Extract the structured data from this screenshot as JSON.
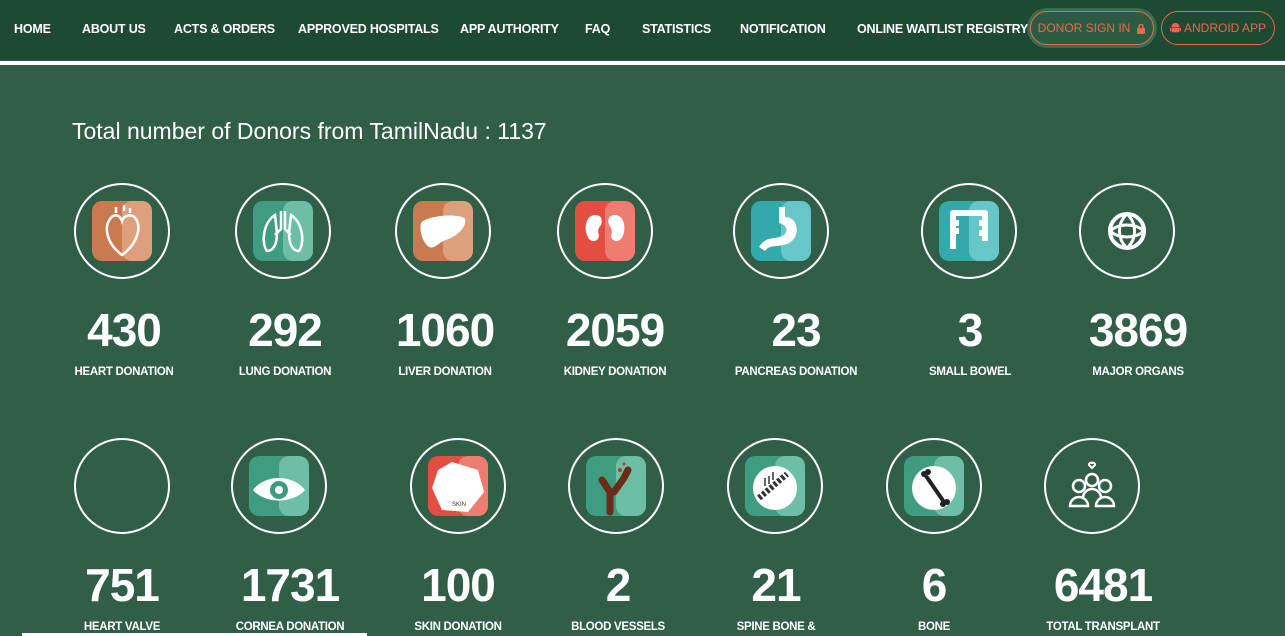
{
  "nav": {
    "items": [
      "HOME",
      "ABOUT US",
      "ACTS & ORDERS",
      "APPROVED HOSPITALS",
      "APP AUTHORITY",
      "FAQ",
      "STATISTICS",
      "NOTIFICATION",
      "ONLINE WAITLIST REGISTRY"
    ],
    "donor_signin": "DONOR SIGN IN",
    "android_app": "ANDROID APP"
  },
  "total_donors": "Total number of Donors from TamilNadu : 1137",
  "row1": [
    {
      "value": "430",
      "label": "HEART DONATION",
      "icon": "heart-icon"
    },
    {
      "value": "292",
      "label": "LUNG DONATION",
      "icon": "lungs-icon"
    },
    {
      "value": "1060",
      "label": "LIVER DONATION",
      "icon": "liver-icon"
    },
    {
      "value": "2059",
      "label": "KIDNEY DONATION",
      "icon": "kidney-icon"
    },
    {
      "value": "23",
      "label": "PANCREAS DONATION",
      "icon": "stomach-icon"
    },
    {
      "value": "3",
      "label": "SMALL BOWEL",
      "icon": "bowel-icon"
    },
    {
      "value": "3869",
      "label": "MAJOR ORGANS",
      "icon": "organs-globe-icon"
    }
  ],
  "row2": [
    {
      "value": "751",
      "label": "HEART VALVE",
      "icon": "heart-valve-icon"
    },
    {
      "value": "1731",
      "label": "CORNEA DONATION",
      "icon": "eye-icon"
    },
    {
      "value": "100",
      "label": "SKIN DONATION",
      "icon": "skin-icon",
      "icon_text": "SKIN"
    },
    {
      "value": "2",
      "label": "BLOOD VESSELS",
      "icon": "blood-vessel-icon"
    },
    {
      "value": "21",
      "label": "SPINE BONE &",
      "icon": "spine-icon"
    },
    {
      "value": "6",
      "label": "BONE",
      "icon": "bone-icon"
    },
    {
      "value": "6481",
      "label": "TOTAL TRANSPLANT",
      "icon": "people-icon"
    }
  ],
  "colors": {
    "background": "#305e47",
    "nav": "#1e4a33",
    "accent": "#e86a4b",
    "orange": "#d4875a",
    "teal": "#4aab91",
    "red": "#e8584a",
    "cyan": "#3fb5b8"
  }
}
